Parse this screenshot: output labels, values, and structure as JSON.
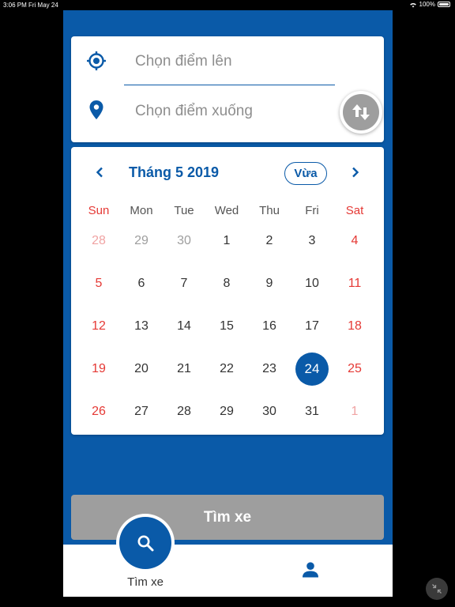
{
  "status_bar": {
    "time": "3:06 PM",
    "date": "Fri May 24",
    "battery": "100%"
  },
  "locations": {
    "pickup_placeholder": "Chọn điểm lên",
    "dropoff_placeholder": "Chọn điểm xuống"
  },
  "calendar": {
    "month_title": "Tháng 5 2019",
    "today_label": "Vừa",
    "weekdays": [
      "Sun",
      "Mon",
      "Tue",
      "Wed",
      "Thu",
      "Fri",
      "Sat"
    ],
    "days": [
      {
        "label": "28",
        "other": true
      },
      {
        "label": "29",
        "other": true
      },
      {
        "label": "30",
        "other": true
      },
      {
        "label": "1"
      },
      {
        "label": "2"
      },
      {
        "label": "3"
      },
      {
        "label": "4"
      },
      {
        "label": "5"
      },
      {
        "label": "6"
      },
      {
        "label": "7"
      },
      {
        "label": "8"
      },
      {
        "label": "9"
      },
      {
        "label": "10"
      },
      {
        "label": "11"
      },
      {
        "label": "12"
      },
      {
        "label": "13"
      },
      {
        "label": "14"
      },
      {
        "label": "15"
      },
      {
        "label": "16"
      },
      {
        "label": "17"
      },
      {
        "label": "18"
      },
      {
        "label": "19"
      },
      {
        "label": "20"
      },
      {
        "label": "21"
      },
      {
        "label": "22"
      },
      {
        "label": "23"
      },
      {
        "label": "24",
        "selected": true
      },
      {
        "label": "25"
      },
      {
        "label": "26"
      },
      {
        "label": "27"
      },
      {
        "label": "28"
      },
      {
        "label": "29"
      },
      {
        "label": "30"
      },
      {
        "label": "31"
      },
      {
        "label": "1",
        "other": true
      }
    ]
  },
  "search_button_label": "Tìm xe",
  "bottom_nav": {
    "search_tab_label": "Tìm xe"
  },
  "colors": {
    "primary": "#0a5aa8",
    "weekend": "#e53935",
    "disabled": "#9e9e9e"
  },
  "icons": {
    "pickup": "crosshair-target-icon",
    "dropoff": "map-pin-icon",
    "swap": "swap-vertical-icon",
    "prev": "chevron-left-icon",
    "next": "chevron-right-icon",
    "search": "search-icon",
    "profile": "person-icon"
  }
}
